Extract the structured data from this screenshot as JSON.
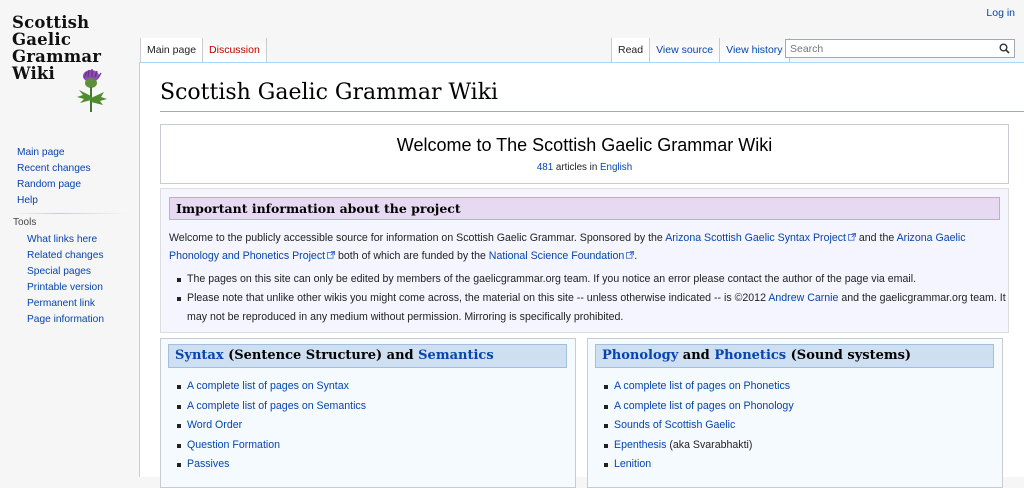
{
  "logo": {
    "line1": "Scottish",
    "line2": "Gaelic",
    "line3": "Grammar",
    "line4": "Wiki"
  },
  "sidebar": {
    "navigation": [
      "Main page",
      "Recent changes",
      "Random page",
      "Help"
    ],
    "tools_heading": "Tools",
    "tools": [
      "What links here",
      "Related changes",
      "Special pages",
      "Printable version",
      "Permanent link",
      "Page information"
    ]
  },
  "personal": {
    "login": "Log in"
  },
  "tabs": {
    "left": [
      "Main page",
      "Discussion"
    ],
    "right": [
      "Read",
      "View source",
      "View history"
    ]
  },
  "search": {
    "placeholder": "Search"
  },
  "page": {
    "title": "Scottish Gaelic Grammar Wiki",
    "welcome": {
      "title": "Welcome to The Scottish Gaelic Grammar Wiki",
      "count": "481",
      "count_suffix": " articles in ",
      "language": "English"
    },
    "info": {
      "heading": "Important information about the project",
      "p1": "Welcome to the publicly accessible source for information on Scottish Gaelic Grammar. Sponsored by the ",
      "link1": "Arizona Scottish Gaelic Syntax Project",
      "p2": " and the ",
      "link2": "Arizona Gaelic Phonology and Phonetics Project",
      "p3": " both of which are funded by the ",
      "link3": "National Science Foundation",
      "p4": ".",
      "bullet1": "The pages on this site can only be edited by members of the gaelicgrammar.org team. If you notice an error please contact the author of the page via email.",
      "bullet2a": "Please note that unlike other wikis you might come across, the material on this site -- unless otherwise indicated -- is ©2012 ",
      "bullet2_link": "Andrew Carnie",
      "bullet2b": " and the gaelicgrammar.org team. It may not be reproduced in any medium without permission. Mirroring is specifically prohibited."
    },
    "syntax": {
      "h_link1": "Syntax",
      "h_text1": " (Sentence Structure) and ",
      "h_link2": "Semantics",
      "items": [
        "A complete list of pages on Syntax",
        "A complete list of pages on Semantics",
        "Word Order",
        "Question Formation",
        "Passives"
      ]
    },
    "phonology": {
      "h_link1": "Phonology",
      "h_text1": " and ",
      "h_link2": "Phonetics",
      "h_text2": " (Sound systems)",
      "items": [
        "A complete list of pages on Phonetics",
        "A complete list of pages on Phonology",
        "Sounds of Scottish Gaelic",
        "Epenthesis",
        "Lenition"
      ],
      "epenthesis_note": " (aka Svarabhakti)"
    }
  },
  "colors": {
    "link": "#0645ad",
    "new_link": "#ba0000",
    "info_heading_bg": "#e7d9f1",
    "column_heading_bg": "#cedff2"
  }
}
